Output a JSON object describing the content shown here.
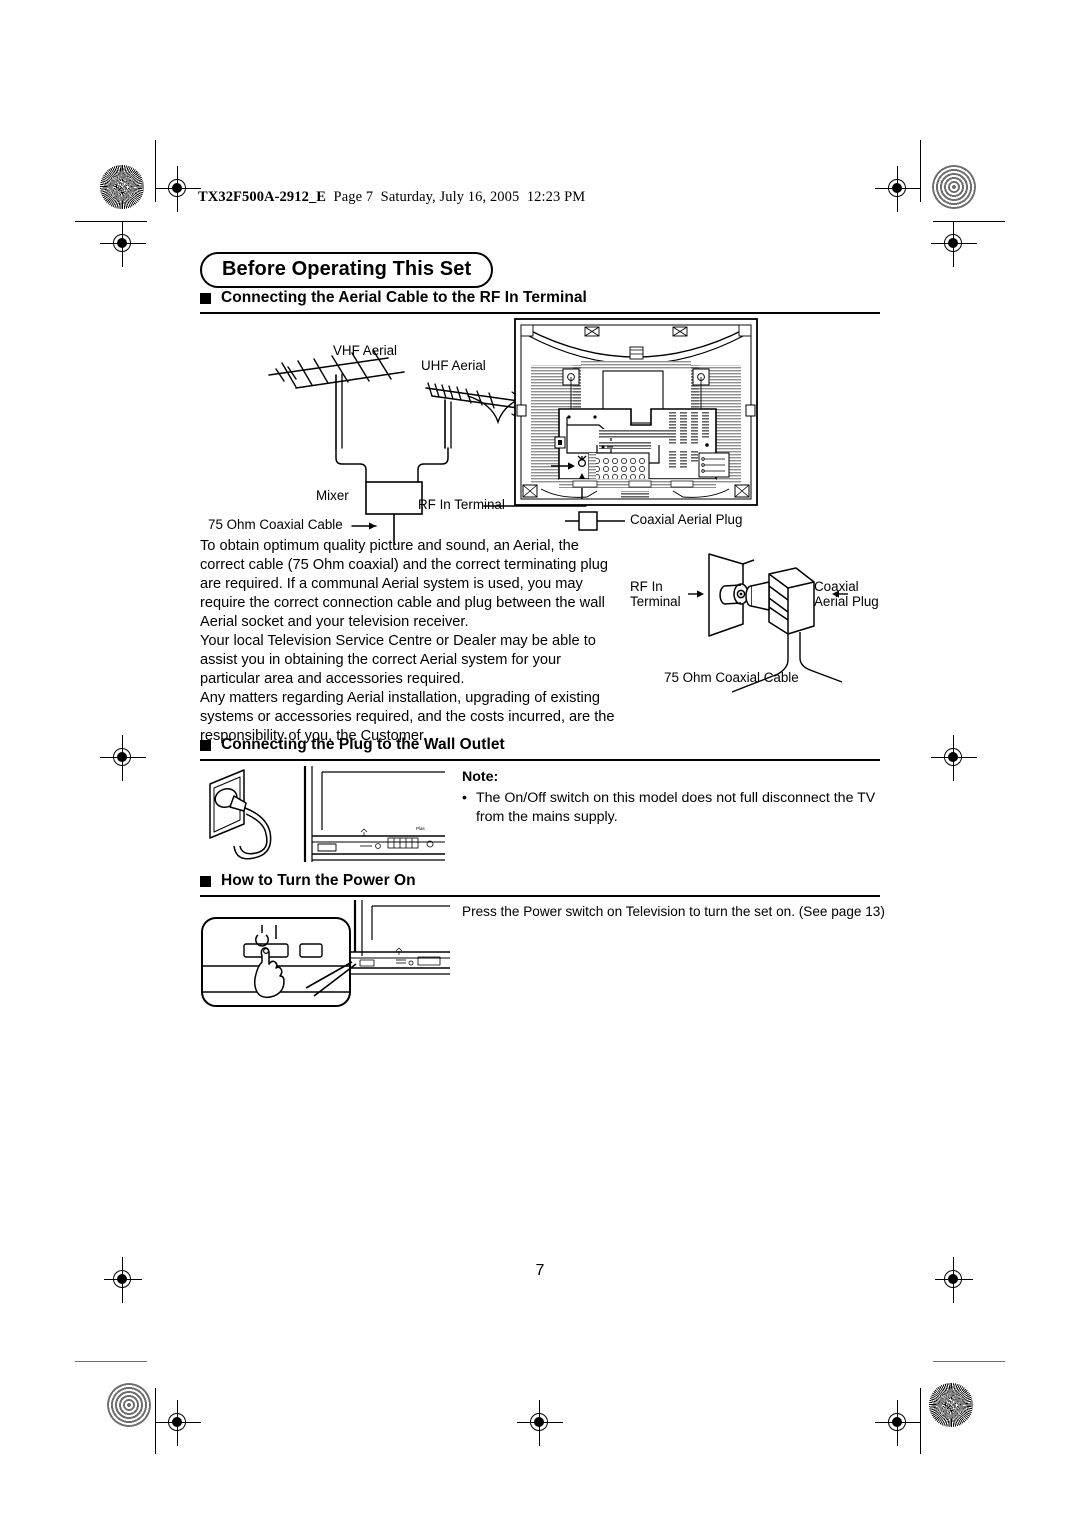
{
  "document": {
    "slug_file": "TX32F500A-2912_E",
    "slug_page": "Page 7",
    "slug_date": "Saturday, July 16, 2005",
    "slug_time": "12:23 PM",
    "page_number": "7"
  },
  "title_badge": "Before Operating This Set",
  "sections": {
    "aerial": {
      "heading": "Connecting the Aerial Cable to the RF In Terminal",
      "figure_labels": {
        "vhf_aerial": "VHF Aerial",
        "uhf_aerial": "UHF Aerial",
        "mixer": "Mixer",
        "coax_cable": "75 Ohm Coaxial Cable",
        "rf_in_terminal": "RF In Terminal",
        "coaxial_aerial_plug": "Coaxial Aerial Plug"
      },
      "paragraphs": [
        "To obtain optimum quality picture and sound, an Aerial, the correct cable (75 Ohm coaxial) and the correct terminating plug are required. If a communal Aerial system is used, you may require the correct connection cable and plug between the wall Aerial socket and your television receiver.",
        "Your local Television Service Centre or Dealer may be able to assist you in obtaining the correct Aerial system for your particular area and accessories required.",
        "Any matters regarding Aerial installation, upgrading of existing systems or accessories required, and the costs incurred, are the responsibility of you, the Customer."
      ],
      "detail_labels": {
        "rf_in_terminal_line1": "RF In",
        "rf_in_terminal_line2": "Terminal",
        "coaxial_line1": "Coaxial",
        "coaxial_line2": "Aerial Plug",
        "coax_cable": "75 Ohm Coaxial Cable"
      }
    },
    "wall_outlet": {
      "heading": "Connecting the Plug to the Wall Outlet",
      "note_title": "Note:",
      "note_bullet": "•",
      "note_text": "The On/Off switch on this model does not full disconnect the TV from the mains supply."
    },
    "power_on": {
      "heading": "How to Turn the Power On",
      "text": "Press the Power switch on Television to turn the set on. (See page 13)"
    }
  }
}
